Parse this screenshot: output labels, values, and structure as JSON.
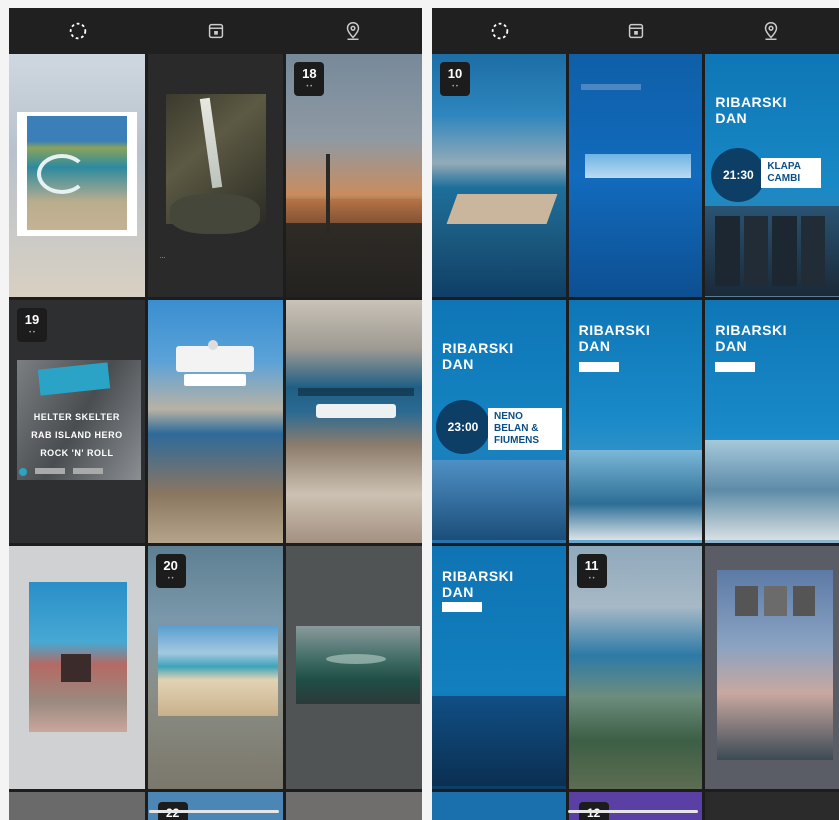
{
  "left_panel": {
    "tabs": [
      {
        "name": "loading",
        "icon": "spinner-icon"
      },
      {
        "name": "calendar",
        "icon": "calendar-icon"
      },
      {
        "name": "location",
        "icon": "location-pin-icon"
      }
    ],
    "tiles": [
      {
        "id": "beach-photo"
      },
      {
        "id": "waterfall"
      },
      {
        "id": "sunset",
        "date": "18"
      },
      {
        "id": "rock-lineup",
        "date": "19",
        "lines": [
          "HELTER SKELTER",
          "RAB ISLAND HERO",
          "ROCK 'N' ROLL"
        ]
      },
      {
        "id": "poll-card"
      },
      {
        "id": "question-card"
      },
      {
        "id": "map-card"
      },
      {
        "id": "sand-beach",
        "date": "20"
      },
      {
        "id": "waves"
      },
      {
        "id": "bottom-1"
      },
      {
        "id": "bottom-2",
        "date": "22"
      },
      {
        "id": "bottom-3"
      }
    ]
  },
  "right_panel": {
    "tabs": [
      {
        "name": "loading",
        "icon": "spinner-icon"
      },
      {
        "name": "calendar",
        "icon": "calendar-icon"
      },
      {
        "name": "location",
        "icon": "location-pin-icon"
      }
    ],
    "tiles": [
      {
        "id": "coast",
        "date": "10"
      },
      {
        "id": "blue-slide"
      },
      {
        "id": "ribarski-klapa",
        "title": "RIBARSKI DAN",
        "time": "21:30",
        "band": "KLAPA CAMBI"
      },
      {
        "id": "ribarski-neno",
        "title": "RIBARSKI DAN",
        "time": "23:00",
        "band": "NENO BELAN & FIUMENS"
      },
      {
        "id": "ribarski-2",
        "title": "RIBARSKI DAN"
      },
      {
        "id": "ribarski-3",
        "title": "RIBARSKI DAN"
      },
      {
        "id": "ribarski-4",
        "title": "RIBARSKI DAN"
      },
      {
        "id": "harbor",
        "date": "11"
      },
      {
        "id": "flags"
      },
      {
        "id": "bottom-1"
      },
      {
        "id": "bottom-2",
        "date": "12"
      },
      {
        "id": "bottom-3"
      }
    ]
  },
  "colors": {
    "ribarski_blue": "#0e76b6",
    "dark_tile": "#2b2b2b"
  }
}
